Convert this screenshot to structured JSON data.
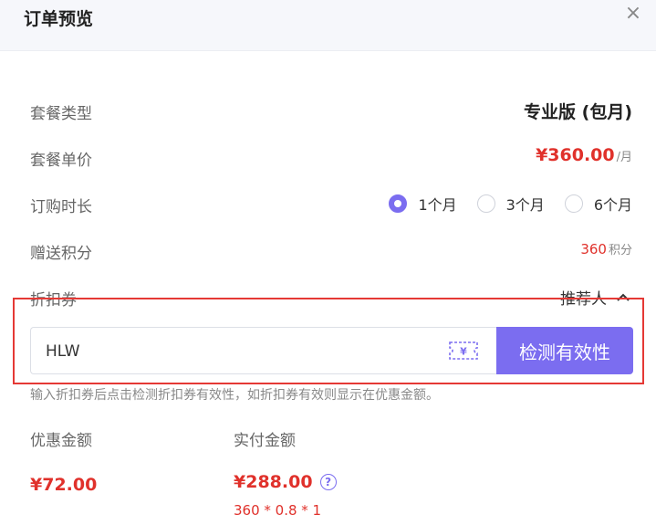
{
  "dialog": {
    "title": "订单预览",
    "close_icon": "×"
  },
  "plan_type": {
    "label": "套餐类型",
    "value": "专业版 (包月)"
  },
  "unit_price": {
    "label": "套餐单价",
    "price": "¥360.00",
    "unit": "/月"
  },
  "duration": {
    "label": "订购时长",
    "options": [
      {
        "label": "1个月",
        "selected": true
      },
      {
        "label": "3个月",
        "selected": false
      },
      {
        "label": "6个月",
        "selected": false
      }
    ]
  },
  "bonus_points": {
    "label": "赠送积分",
    "value": "360",
    "unit": "积分"
  },
  "coupon": {
    "label": "折扣券",
    "referrer_label": "推荐人",
    "input_value": "HLW",
    "check_button": "检测有效性",
    "hint": "输入折扣券后点击检测折扣券有效性，如折扣券有效则显示在优惠金额。"
  },
  "summary": {
    "discount_label": "优惠金额",
    "discount_value": "¥72.00",
    "paid_label": "实付金额",
    "paid_value": "¥288.00",
    "help_icon": "?",
    "formula": "360 * 0.8 * 1"
  },
  "colors": {
    "accent": "#7b6df0",
    "price": "#e0312b",
    "highlight_border": "#e53935"
  }
}
